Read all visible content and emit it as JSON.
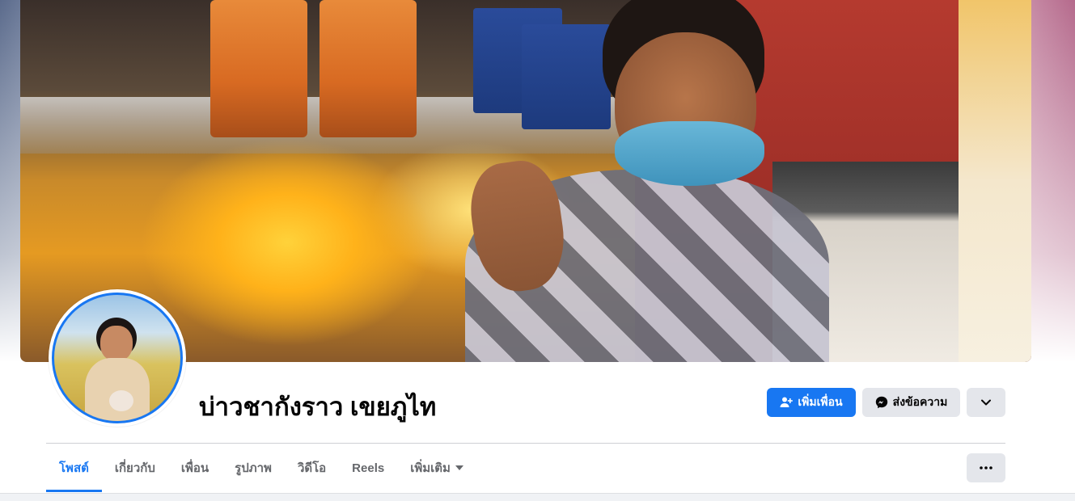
{
  "profile": {
    "name": "บ่าวชากังราว เขยภูไท"
  },
  "actions": {
    "add_friend_label": "เพิ่มเพื่อน",
    "message_label": "ส่งข้อความ"
  },
  "tabs": [
    {
      "label": "โพสต์",
      "active": true
    },
    {
      "label": "เกี่ยวกับ",
      "active": false
    },
    {
      "label": "เพื่อน",
      "active": false
    },
    {
      "label": "รูปภาพ",
      "active": false
    },
    {
      "label": "วิดีโอ",
      "active": false
    },
    {
      "label": "Reels",
      "active": false
    },
    {
      "label": "เพิ่มเติม",
      "active": false
    }
  ],
  "colors": {
    "accent": "#1877f2",
    "secondary_button": "#e4e6eb",
    "text_primary": "#050505",
    "text_secondary": "#65676b"
  },
  "icons": {
    "add_friend": "person-plus-icon",
    "message": "messenger-icon",
    "expand": "chevron-down-icon",
    "more": "ellipsis-icon",
    "tab_more": "caret-down-icon"
  }
}
